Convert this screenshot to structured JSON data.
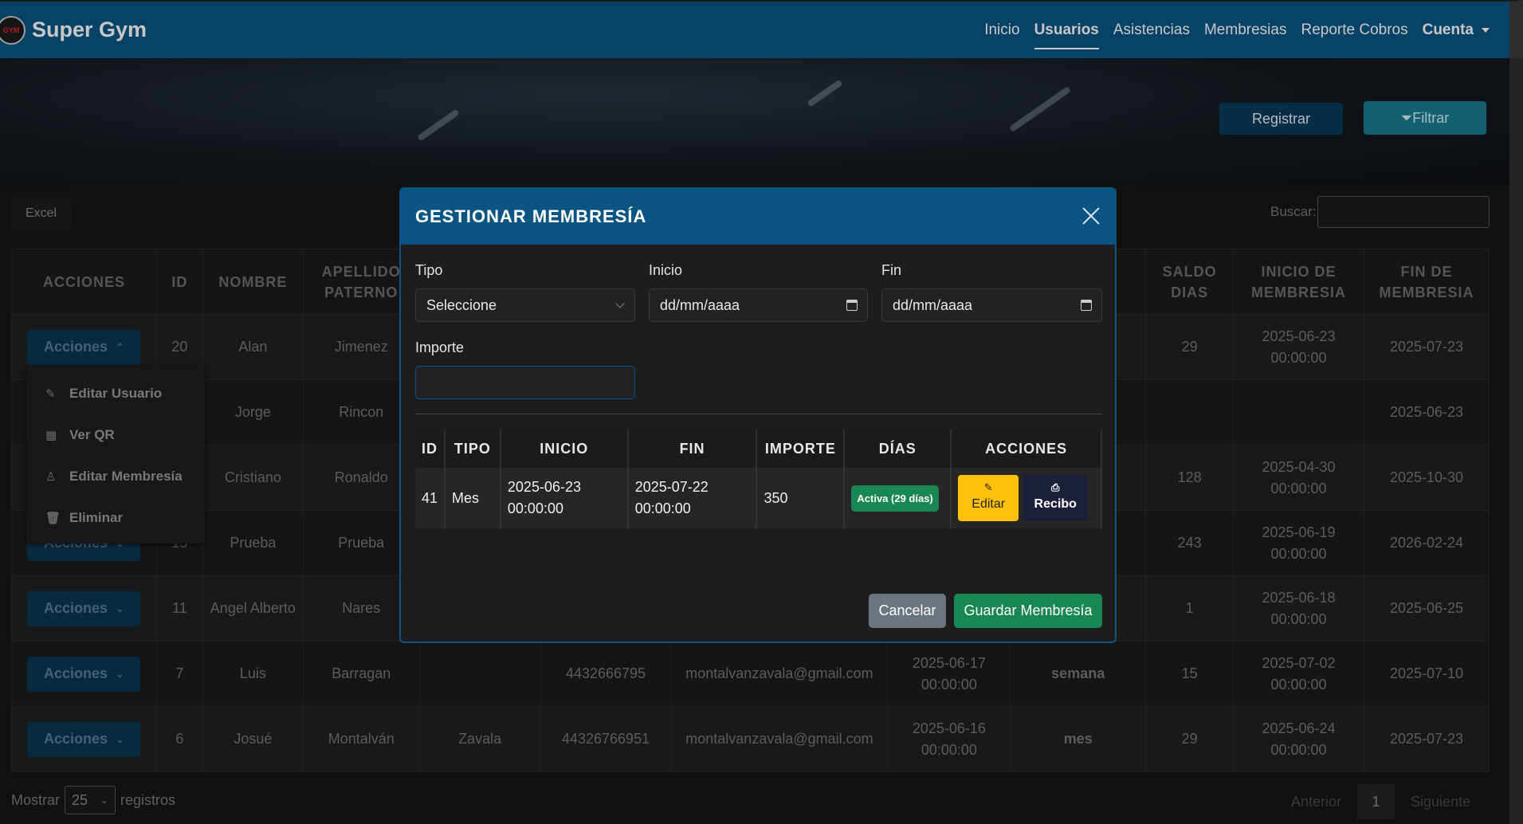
{
  "navbar": {
    "brand": "Super Gym",
    "logo_text": "GYM",
    "links": [
      "Inicio",
      "Usuarios",
      "Asistencias",
      "Membresias",
      "Reporte Cobros",
      "Cuenta"
    ]
  },
  "toolbar": {
    "registrar": "Registrar",
    "filtrar": "Filtrar",
    "excel": "Excel",
    "buscar_label": "Buscar:"
  },
  "table": {
    "headers": [
      "ACCIONES",
      "ID",
      "NOMBRE",
      "APELLIDO PATERNO",
      "",
      "",
      "",
      "",
      "",
      "SALDO DIAS",
      "INICIO DE MEMBRESIA",
      "FIN DE MEMBRESIA"
    ],
    "acciones_label": "Acciones",
    "rows": [
      {
        "id": "20",
        "nombre": "Alan",
        "paterno": "Jimenez",
        "materno": "",
        "telefono": "",
        "correo": "",
        "registro": "",
        "tipo": "",
        "saldo": "29",
        "inicio": "2025-06-23 00:00:00",
        "fin": "2025-07-23"
      },
      {
        "id": "",
        "nombre": "Jorge",
        "paterno": "Rincon",
        "materno": "",
        "telefono": "",
        "correo": "",
        "registro": "",
        "tipo": "",
        "saldo": "",
        "inicio": "",
        "fin": "2025-06-23"
      },
      {
        "id": "",
        "nombre": "Cristiano",
        "paterno": "Ronaldo",
        "materno": "",
        "telefono": "",
        "correo": "",
        "registro": "",
        "tipo": "",
        "saldo": "128",
        "inicio": "2025-04-30 00:00:00",
        "fin": "2025-10-30"
      },
      {
        "id": "15",
        "nombre": "Prueba",
        "paterno": "Prueba",
        "materno": "",
        "telefono": "",
        "correo": "",
        "registro": "",
        "tipo": "",
        "saldo": "243",
        "inicio": "2025-06-19 00:00:00",
        "fin": "2026-02-24"
      },
      {
        "id": "11",
        "nombre": "Angel Alberto",
        "paterno": "Nares",
        "materno": "",
        "telefono": "",
        "correo": "",
        "registro": "",
        "tipo": "",
        "saldo": "1",
        "inicio": "2025-06-18 00:00:00",
        "fin": "2025-06-25"
      },
      {
        "id": "7",
        "nombre": "Luis",
        "paterno": "Barragan",
        "materno": "",
        "telefono": "4432666795",
        "correo": "montalvanzavala@gmail.com",
        "registro": "2025-06-17 00:00:00",
        "tipo": "semana",
        "saldo": "15",
        "inicio": "2025-07-02 00:00:00",
        "fin": "2025-07-10"
      },
      {
        "id": "6",
        "nombre": "Josué",
        "paterno": "Montalván",
        "materno": "Zavala",
        "telefono": "44326766951",
        "correo": "montalvanzavala@gmail.com",
        "registro": "2025-06-16 00:00:00",
        "tipo": "mes",
        "saldo": "29",
        "inicio": "2025-06-24 00:00:00",
        "fin": "2025-07-23"
      }
    ]
  },
  "dropdown": {
    "items": [
      {
        "icon": "edit-icon",
        "label": "Editar Usuario"
      },
      {
        "icon": "qr-icon",
        "label": "Ver QR"
      },
      {
        "icon": "user-icon",
        "label": "Editar Membresía"
      },
      {
        "icon": "trash-icon",
        "label": "Eliminar"
      }
    ]
  },
  "footer": {
    "mostrar": "Mostrar",
    "length_value": "25",
    "registros": "registros",
    "anterior": "Anterior",
    "page": "1",
    "siguiente": "Siguiente"
  },
  "modal": {
    "title": "GESTIONAR MEMBRESÍA",
    "tipo_label": "Tipo",
    "tipo_value": "Seleccione",
    "inicio_label": "Inicio",
    "inicio_placeholder": "dd/mm/aaaa",
    "fin_label": "Fin",
    "fin_placeholder": "dd/mm/aaaa",
    "importe_label": "Importe",
    "importe_value": "",
    "table_headers": [
      "ID",
      "TIPO",
      "INICIO",
      "FIN",
      "IMPORTE",
      "DÍAS",
      "ACCIONES"
    ],
    "rows": [
      {
        "id": "41",
        "tipo": "Mes",
        "inicio": "2025-06-23 00:00:00",
        "fin": "2025-07-22 00:00:00",
        "importe": "350",
        "dias": "Activa (29 días)",
        "editar": "Editar",
        "recibo": "Recibo"
      }
    ],
    "cancel": "Cancelar",
    "save": "Guardar Membresía"
  },
  "colors": {
    "navbar": "#0b5583",
    "registrar": "#0b3a5c",
    "filtrar": "#167d94",
    "badge": "#198754",
    "editar": "#ffc107",
    "cancel": "#6c757d",
    "save": "#198754"
  }
}
